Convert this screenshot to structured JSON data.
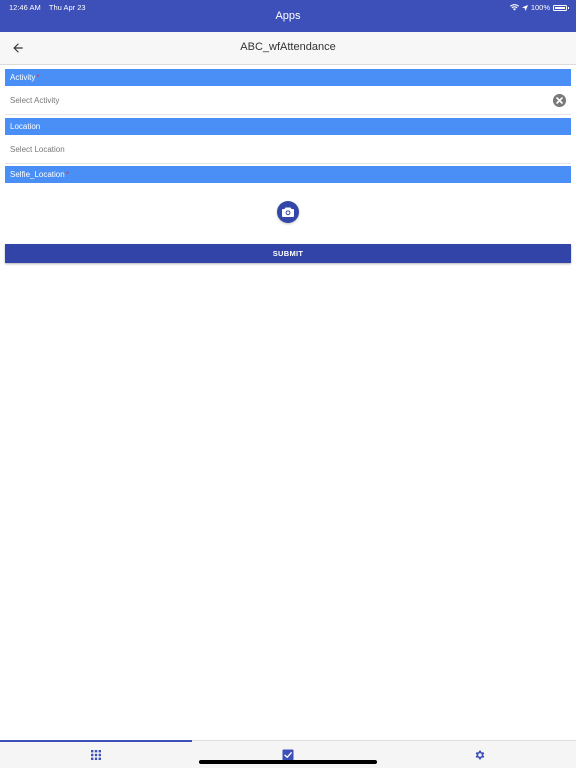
{
  "status_bar": {
    "time": "12:46 AM",
    "date": "Thu Apr 23",
    "battery": "100%",
    "battery_level": 1.0,
    "icons": [
      "wifi-icon",
      "location-arrow-icon",
      "battery-icon"
    ]
  },
  "app_bar": {
    "title": "Apps"
  },
  "nav_bar": {
    "title": "ABC_wfAttendance",
    "back_icon": "arrow-left-icon"
  },
  "form": {
    "sections": [
      {
        "label": "Activity",
        "required": true,
        "required_mark": "*",
        "placeholder": "Select Activity",
        "clear_icon": "close-circle-icon"
      },
      {
        "label": "Location",
        "required": false,
        "placeholder": "Select Location"
      },
      {
        "label": "Selfie_Location",
        "required": true,
        "required_mark": "*",
        "action_icon": "camera-icon"
      }
    ],
    "submit_label": "SUBMIT"
  },
  "tab_bar": {
    "tabs": [
      {
        "icon": "grid-icon",
        "active": true
      },
      {
        "icon": "checkbox-icon",
        "active": false
      },
      {
        "icon": "gear-icon",
        "active": false
      }
    ]
  },
  "colors": {
    "app_bar": "#3d4fb8",
    "section_header": "#4a8ff5",
    "submit": "#3344a8",
    "camera_button": "#3247a8",
    "tab_icon": "#3d4fb8",
    "required": "#e53935"
  }
}
